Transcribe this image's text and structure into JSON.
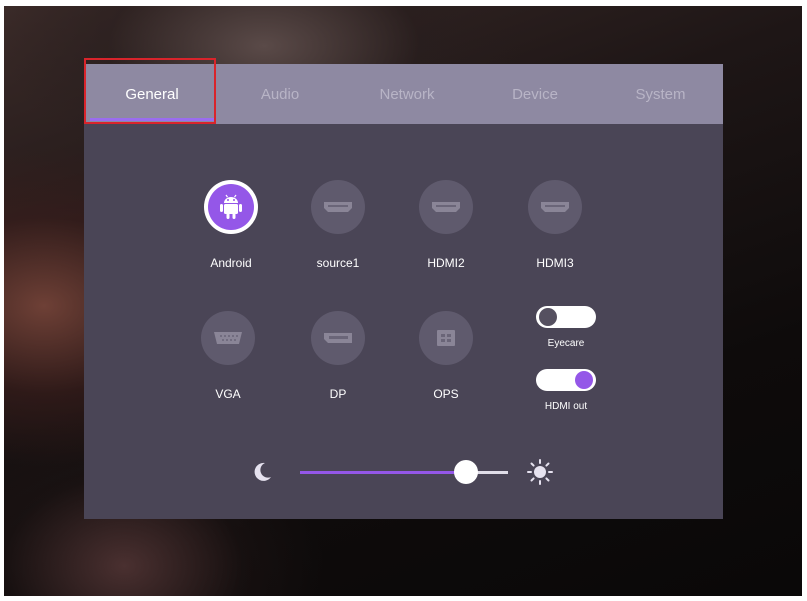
{
  "tabs": [
    {
      "label": "General",
      "active": true
    },
    {
      "label": "Audio",
      "active": false
    },
    {
      "label": "Network",
      "active": false
    },
    {
      "label": "Device",
      "active": false
    },
    {
      "label": "System",
      "active": false
    }
  ],
  "sources": [
    {
      "label": "Android",
      "icon": "android-icon",
      "selected": true
    },
    {
      "label": "source1",
      "icon": "hdmi-port-icon",
      "selected": false
    },
    {
      "label": "HDMI2",
      "icon": "hdmi-port-icon",
      "selected": false
    },
    {
      "label": "HDMI3",
      "icon": "hdmi-port-icon",
      "selected": false
    },
    {
      "label": "VGA",
      "icon": "vga-port-icon",
      "selected": false
    },
    {
      "label": "DP",
      "icon": "displayport-icon",
      "selected": false
    },
    {
      "label": "OPS",
      "icon": "ops-slot-icon",
      "selected": false
    }
  ],
  "toggles": {
    "eyecare": {
      "label": "Eyecare",
      "on": false
    },
    "hdmi_out": {
      "label": "HDMI out",
      "on": true
    }
  },
  "brightness": {
    "level": 0.8,
    "min_icon": "moon-icon",
    "max_icon": "sun-icon"
  },
  "colors": {
    "accent": "#9457e8",
    "panel": "#4a4556",
    "tabbar": "#8e89a2",
    "selection_outline": "#d9242b"
  }
}
